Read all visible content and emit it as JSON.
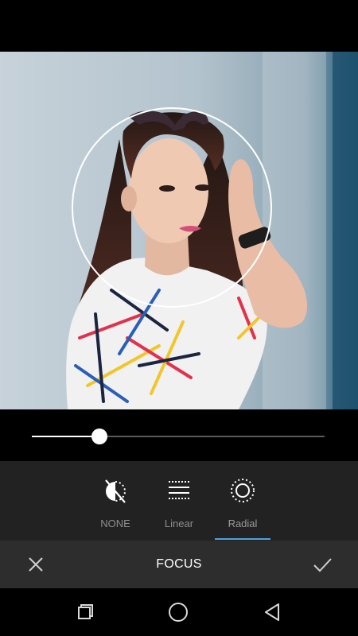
{
  "screen": {
    "title": "FOCUS"
  },
  "slider": {
    "value_fraction": 0.23
  },
  "modes": [
    {
      "label": "NONE",
      "icon": "focus-off-icon",
      "selected": false
    },
    {
      "label": "Linear",
      "icon": "linear-focus-icon",
      "selected": false
    },
    {
      "label": "Radial",
      "icon": "radial-focus-icon",
      "selected": true
    }
  ],
  "actions": {
    "cancel_icon": "close-icon",
    "confirm_icon": "check-icon"
  },
  "navigation": {
    "recents_icon": "recents-icon",
    "home_icon": "home-icon",
    "back_icon": "back-icon"
  },
  "colors": {
    "accent": "#4ba3e3",
    "panel": "#222222",
    "action_bar": "#2d2d2d"
  }
}
